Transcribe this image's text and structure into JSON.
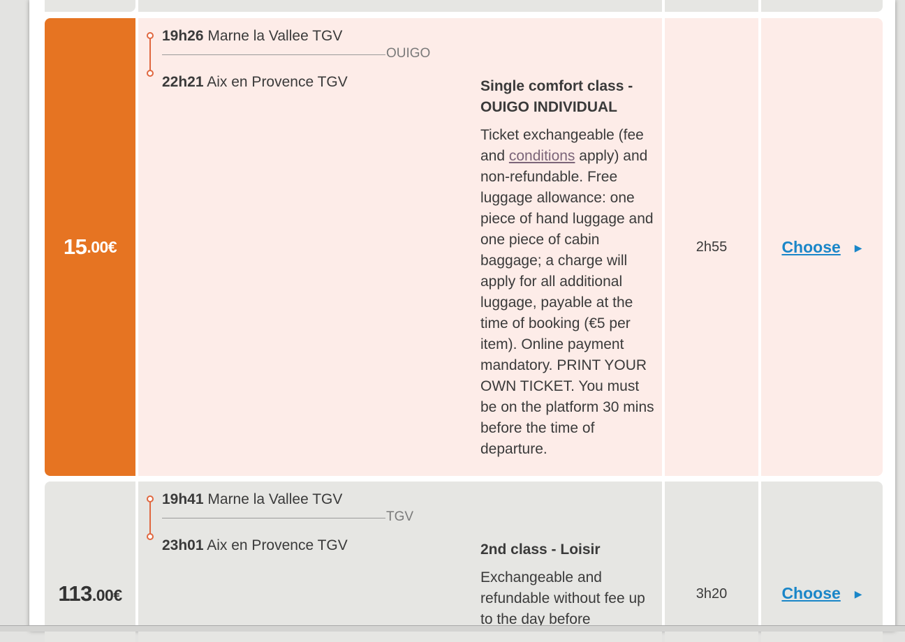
{
  "colors": {
    "accent_orange": "#e67422",
    "highlight_row_bg": "#fdece8",
    "gray_row_bg": "#e6e6e3",
    "link_blue": "#1a86c8"
  },
  "results": [
    {
      "price_main": "15",
      "price_decimals": ".00€",
      "departure_time": "19h26",
      "departure_station": "Marne la Vallee TGV",
      "arrival_time": "22h21",
      "arrival_station": "Aix en Provence TGV",
      "operator": "OUIGO",
      "fare_title": "Single comfort class - OUIGO INDIVIDUAL",
      "fare_desc_before": "Ticket exchangeable (fee and ",
      "fare_desc_link": "conditions",
      "fare_desc_after": " apply) and non-refundable. Free luggage allowance: one piece of hand luggage and one piece of cabin baggage; a charge will apply for all additional luggage, payable at the time of booking (€5 per item). Online payment mandatory. PRINT YOUR OWN TICKET. You must be on the platform 30 mins before the time of departure.",
      "duration": "2h55",
      "choose_label": "Choose",
      "arrow_icon": "triangle-right-icon"
    },
    {
      "price_main": "113",
      "price_decimals": ".00€",
      "departure_time": "19h41",
      "departure_station": "Marne la Vallee TGV",
      "arrival_time": "23h01",
      "arrival_station": "Aix en Provence TGV",
      "operator": "TGV",
      "fare_title": "2nd class - Loisir",
      "fare_desc_before": "Exchangeable and refundable without fee up to the day before",
      "duration": "3h20",
      "choose_label": "Choose",
      "arrow_icon": "triangle-right-icon"
    }
  ]
}
